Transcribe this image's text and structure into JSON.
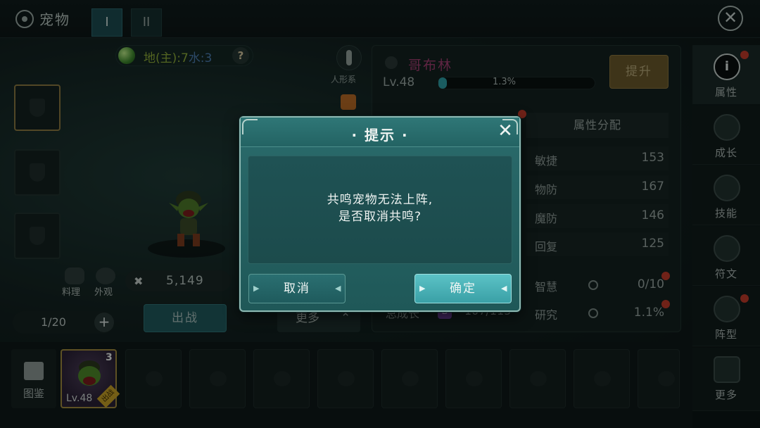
{
  "topbar": {
    "title": "宠物",
    "tab1": "I",
    "tab2": "II",
    "close_symbol": "✕"
  },
  "element_info": {
    "earth": "地(主):7",
    "water": "水:3",
    "help": "?"
  },
  "side_label": "人形系",
  "power": {
    "value": "5,149"
  },
  "actions": {
    "cook": "料理",
    "appearance": "外观"
  },
  "capacity": {
    "text": "1/20",
    "plus": "+"
  },
  "buttons": {
    "sortie": "出战",
    "more": "更多"
  },
  "pet": {
    "name": "哥布林",
    "level": "Lv.48",
    "exp_text": "1.3%",
    "exp_fraction": 0.013,
    "upgrade": "提升"
  },
  "attr_tab": "属性分配",
  "attributes": [
    {
      "name": "敏捷",
      "value": "153"
    },
    {
      "name": "物防",
      "value": "167"
    },
    {
      "name": "魔防",
      "value": "146"
    },
    {
      "name": "回复",
      "value": "125"
    }
  ],
  "extra_stats": [
    {
      "name": "智慧",
      "value": "0/10"
    },
    {
      "name": "研究",
      "value": "1.1%"
    }
  ],
  "total_growth": {
    "label": "总成长",
    "badge": "B",
    "value": "107/115"
  },
  "right_nav": [
    {
      "label": "属性",
      "icon_char": "i"
    },
    {
      "label": "成长",
      "icon_char": ""
    },
    {
      "label": "技能",
      "icon_char": ""
    },
    {
      "label": "符文",
      "icon_char": ""
    },
    {
      "label": "阵型",
      "icon_char": ""
    },
    {
      "label": "更多",
      "icon_char": ""
    }
  ],
  "bottom": {
    "handbook": "图鉴",
    "owned_card": {
      "level": "Lv.48",
      "count": "3",
      "tag": "出战"
    }
  },
  "dialog": {
    "title": "· 提示 ·",
    "close_symbol": "✕",
    "message_line1": "共鸣宠物无法上阵,",
    "message_line2": "是否取消共鸣?",
    "cancel": "取消",
    "confirm": "确定"
  }
}
